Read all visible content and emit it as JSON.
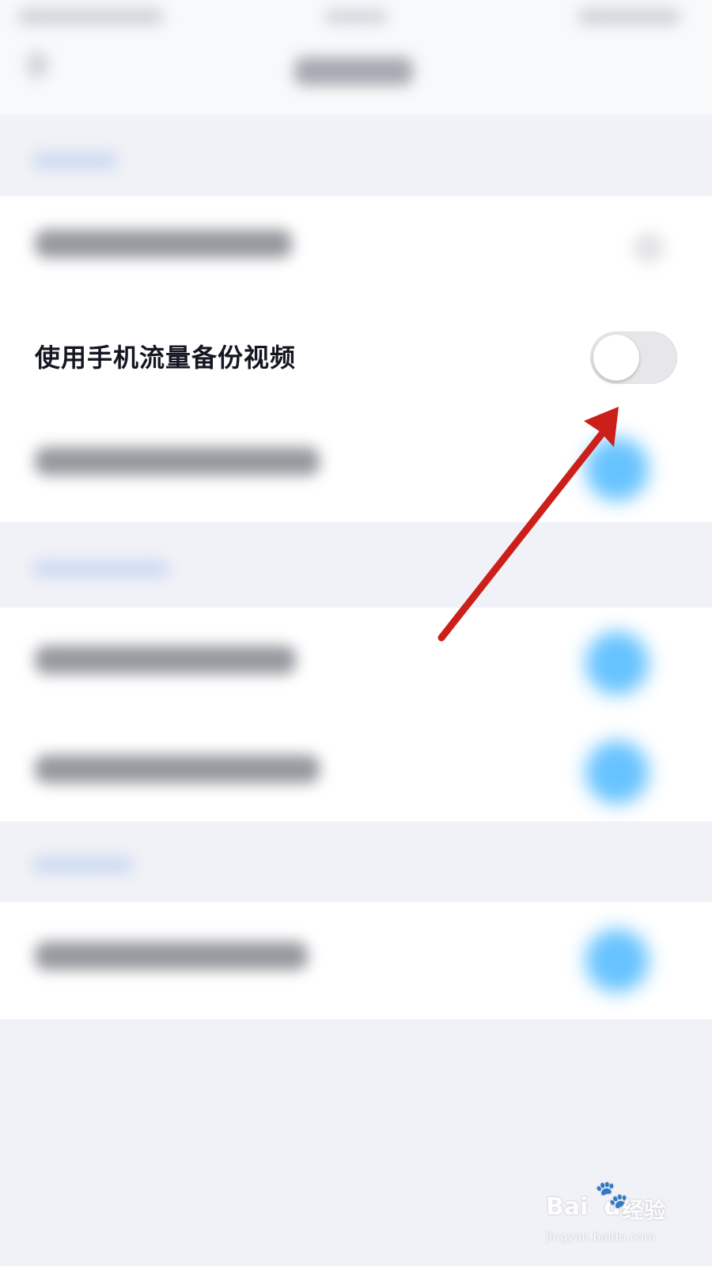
{
  "settings": {
    "data_backup_row": {
      "label": "使用手机流量备份视频",
      "toggle_on": false
    }
  },
  "colors": {
    "toggle_on_blue": "#5fc0ff",
    "toggle_off_track": "#e7e7ea",
    "annotation_arrow": "#cc1f1a"
  },
  "watermark": {
    "brand": "Bai",
    "brand_tail": "du",
    "paw": "🐾",
    "cn": "经验",
    "url": "jingyan.baidu.com"
  }
}
